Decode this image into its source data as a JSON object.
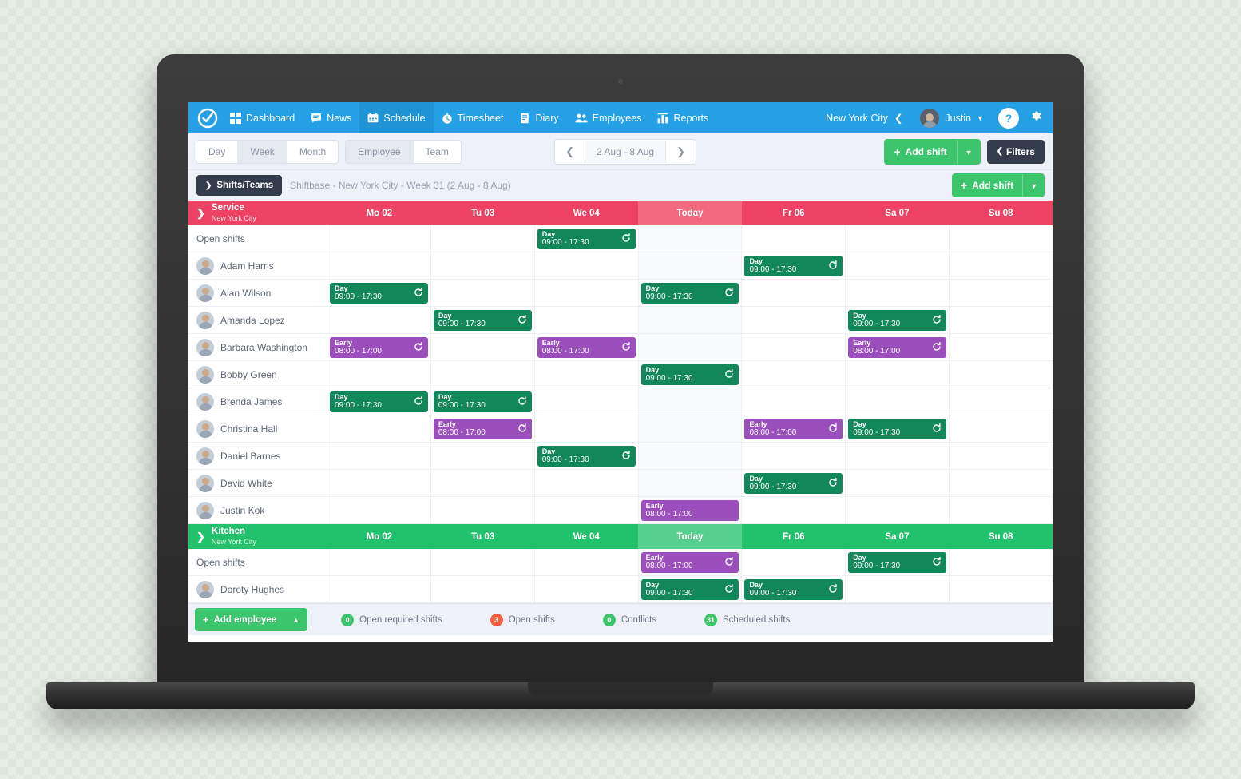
{
  "topnav": {
    "logo_icon": "check-circle-logo",
    "items": [
      {
        "label": "Dashboard",
        "icon": "grid-icon",
        "active": false
      },
      {
        "label": "News",
        "icon": "chat-bubble-icon",
        "active": false
      },
      {
        "label": "Schedule",
        "icon": "calendar-icon",
        "active": true
      },
      {
        "label": "Timesheet",
        "icon": "clock-icon",
        "active": false
      },
      {
        "label": "Diary",
        "icon": "book-icon",
        "active": false
      },
      {
        "label": "Employees",
        "icon": "people-icon",
        "active": false
      },
      {
        "label": "Reports",
        "icon": "bar-chart-icon",
        "active": false
      }
    ],
    "city": "New York City",
    "city_chevron_icon": "chevron-left-icon",
    "user": "Justin",
    "user_chevron_icon": "chevron-down-icon",
    "help_label": "?",
    "gear_icon": "gear-icon",
    "accent_color": "#26a0e4"
  },
  "toolbar": {
    "views": [
      {
        "label": "Day",
        "selected": false
      },
      {
        "label": "Week",
        "selected": true
      },
      {
        "label": "Month",
        "selected": false
      }
    ],
    "groupings": [
      {
        "label": "Employee",
        "selected": true
      },
      {
        "label": "Team",
        "selected": false
      }
    ],
    "prev_icon": "chevron-left-icon",
    "next_icon": "chevron-right-icon",
    "date_range": "2 Aug - 8 Aug",
    "add_shift_label": "Add shift",
    "add_shift_plus_icon": "plus-icon",
    "add_shift_caret_icon": "chevron-down-icon",
    "filters_label": "Filters",
    "filters_icon": "chevron-left-icon"
  },
  "subheader": {
    "shifts_teams_label": "Shifts/Teams",
    "shifts_teams_icon": "chevron-right-icon",
    "breadcrumb": "Shiftbase - New York City - Week 31 (2 Aug - 8 Aug)",
    "add_shift_label": "Add shift",
    "add_shift_plus_icon": "plus-icon",
    "add_shift_caret_icon": "chevron-down-icon"
  },
  "colors": {
    "service_header": "#ed4264",
    "service_header_today": "#f1697f",
    "kitchen_header": "#22c16b",
    "kitchen_header_today": "#55d08f",
    "shift_green": "#12875a",
    "shift_purple": "#9a4fbd",
    "green_button": "#3dc56d",
    "dark_button": "#343b4c"
  },
  "days": [
    "Mo 02",
    "Tu 03",
    "We 04",
    "Today",
    "Fr 06",
    "Sa 07",
    "Su 08"
  ],
  "groups": [
    {
      "name": "Service",
      "location": "New York City",
      "collapse_icon": "chevron-right-icon",
      "days": [
        "Mo 02",
        "Tu 03",
        "We 04",
        "Today",
        "Fr 06",
        "Sa 07",
        "Su 08"
      ],
      "rows": [
        {
          "name": "Open shifts",
          "avatar": false,
          "shifts": [
            null,
            null,
            {
              "title": "Day",
              "time": "09:00 - 17:30",
              "color": "green",
              "repeat": true
            },
            null,
            null,
            null,
            null
          ]
        },
        {
          "name": "Adam Harris",
          "avatar": true,
          "shifts": [
            null,
            null,
            null,
            null,
            {
              "title": "Day",
              "time": "09:00 - 17:30",
              "color": "green",
              "repeat": true
            },
            null,
            null
          ]
        },
        {
          "name": "Alan Wilson",
          "avatar": true,
          "shifts": [
            {
              "title": "Day",
              "time": "09:00 - 17:30",
              "color": "green",
              "repeat": true
            },
            null,
            null,
            {
              "title": "Day",
              "time": "09:00 - 17:30",
              "color": "green",
              "repeat": true
            },
            null,
            null,
            null
          ]
        },
        {
          "name": "Amanda Lopez",
          "avatar": true,
          "shifts": [
            null,
            {
              "title": "Day",
              "time": "09:00 - 17:30",
              "color": "green",
              "repeat": true
            },
            null,
            null,
            null,
            {
              "title": "Day",
              "time": "09:00 - 17:30",
              "color": "green",
              "repeat": true
            },
            null
          ]
        },
        {
          "name": "Barbara Washington",
          "avatar": true,
          "shifts": [
            {
              "title": "Early",
              "time": "08:00 - 17:00",
              "color": "purple",
              "repeat": true
            },
            null,
            {
              "title": "Early",
              "time": "08:00 - 17:00",
              "color": "purple",
              "repeat": true
            },
            null,
            null,
            {
              "title": "Early",
              "time": "08:00 - 17:00",
              "color": "purple",
              "repeat": true
            },
            null
          ]
        },
        {
          "name": "Bobby Green",
          "avatar": true,
          "shifts": [
            null,
            null,
            null,
            {
              "title": "Day",
              "time": "09:00 - 17:30",
              "color": "green",
              "repeat": true
            },
            null,
            null,
            null
          ]
        },
        {
          "name": "Brenda James",
          "avatar": true,
          "shifts": [
            {
              "title": "Day",
              "time": "09:00 - 17:30",
              "color": "green",
              "repeat": true
            },
            {
              "title": "Day",
              "time": "09:00 - 17:30",
              "color": "green",
              "repeat": true
            },
            null,
            null,
            null,
            null,
            null
          ]
        },
        {
          "name": "Christina Hall",
          "avatar": true,
          "shifts": [
            null,
            {
              "title": "Early",
              "time": "08:00 - 17:00",
              "color": "purple",
              "repeat": true
            },
            null,
            null,
            {
              "title": "Early",
              "time": "08:00 - 17:00",
              "color": "purple",
              "repeat": true
            },
            {
              "title": "Day",
              "time": "09:00 - 17:30",
              "color": "green",
              "repeat": true
            },
            null
          ]
        },
        {
          "name": "Daniel Barnes",
          "avatar": true,
          "shifts": [
            null,
            null,
            {
              "title": "Day",
              "time": "09:00 - 17:30",
              "color": "green",
              "repeat": true
            },
            null,
            null,
            null,
            null
          ]
        },
        {
          "name": "David White",
          "avatar": true,
          "shifts": [
            null,
            null,
            null,
            null,
            {
              "title": "Day",
              "time": "09:00 - 17:30",
              "color": "green",
              "repeat": true
            },
            null,
            null
          ]
        },
        {
          "name": "Justin Kok",
          "avatar": true,
          "shifts": [
            null,
            null,
            null,
            {
              "title": "Early",
              "time": "08:00 - 17:00",
              "color": "purple",
              "repeat": false
            },
            null,
            null,
            null
          ]
        }
      ]
    },
    {
      "name": "Kitchen",
      "location": "New York City",
      "collapse_icon": "chevron-right-icon",
      "days": [
        "Mo 02",
        "Tu 03",
        "We 04",
        "Today",
        "Fr 06",
        "Sa 07",
        "Su 08"
      ],
      "rows": [
        {
          "name": "Open shifts",
          "avatar": false,
          "shifts": [
            null,
            null,
            null,
            {
              "title": "Early",
              "time": "08:00 - 17:00",
              "color": "purple",
              "repeat": true
            },
            null,
            {
              "title": "Day",
              "time": "09:00 - 17:30",
              "color": "green",
              "repeat": true
            },
            null
          ]
        },
        {
          "name": "Doroty Hughes",
          "avatar": true,
          "shifts": [
            null,
            null,
            null,
            {
              "title": "Day",
              "time": "09:00 - 17:30",
              "color": "green",
              "repeat": true
            },
            {
              "title": "Day",
              "time": "09:00 - 17:30",
              "color": "green",
              "repeat": true
            },
            null,
            null
          ]
        }
      ]
    }
  ],
  "footer": {
    "add_employee_label": "Add employee",
    "add_employee_plus_icon": "plus-icon",
    "add_employee_caret_icon": "chevron-up-icon",
    "stats": [
      {
        "count": "0",
        "label": "Open required shifts",
        "color": "green"
      },
      {
        "count": "3",
        "label": "Open shifts",
        "color": "red"
      },
      {
        "count": "0",
        "label": "Conflicts",
        "color": "green"
      },
      {
        "count": "31",
        "label": "Scheduled shifts",
        "color": "green"
      }
    ]
  }
}
